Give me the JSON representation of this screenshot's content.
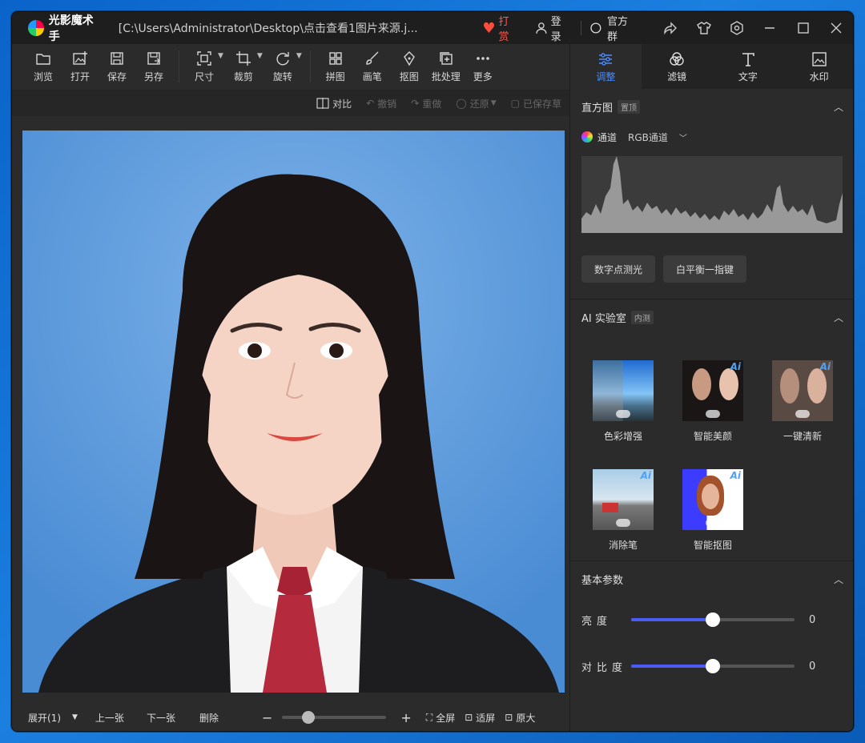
{
  "title": {
    "app_name": "光影魔术手",
    "path": "[C:\\Users\\Administrator\\Desktop\\点击查看1图片来源.j...",
    "tip": "打赏",
    "login": "登录",
    "group": "官方群"
  },
  "toolbar": {
    "browse": "浏览",
    "open": "打开",
    "save": "保存",
    "save_as": "另存",
    "size": "尺寸",
    "crop": "裁剪",
    "rotate": "旋转",
    "collage": "拼图",
    "brush": "画笔",
    "cutout": "抠图",
    "batch": "批处理",
    "more": "更多"
  },
  "subbar": {
    "compare": "对比",
    "undo": "撤销",
    "redo": "重做",
    "restore": "还原",
    "save_draft": "已保存草"
  },
  "bottombar": {
    "expand": "展开(1)",
    "prev": "上一张",
    "next": "下一张",
    "delete": "删除",
    "fullscreen": "全屏",
    "fit": "适屏",
    "original": "原大",
    "zoom_level": 0.25
  },
  "tabs": [
    {
      "label": "调整",
      "active": true
    },
    {
      "label": "滤镜",
      "active": false
    },
    {
      "label": "文字",
      "active": false
    },
    {
      "label": "水印",
      "active": false
    }
  ],
  "histogram": {
    "title": "直方图",
    "badge": "置顶",
    "channel_label": "通道",
    "channel_value": "RGB通道"
  },
  "buttons": {
    "spot_metering": "数字点测光",
    "white_balance": "白平衡一指键"
  },
  "ai_lab": {
    "title": "AI 实验室",
    "badge": "内测",
    "items": [
      {
        "label": "色彩增强"
      },
      {
        "label": "智能美颜"
      },
      {
        "label": "一键清新"
      },
      {
        "label": "消除笔"
      },
      {
        "label": "智能抠图"
      }
    ],
    "tag": "Ai"
  },
  "basic_params": {
    "title": "基本参数",
    "brightness_label": "亮度",
    "brightness_value": "0",
    "contrast_label": "对比度",
    "contrast_value": "0",
    "brightness_level": 0.5,
    "contrast_level": 0.5
  },
  "colors": {
    "accent": "#4a8cff",
    "slider_fill": "#4a5cf5",
    "tip": "#ff5a4e",
    "photo_bg": "#4b8ed6"
  }
}
